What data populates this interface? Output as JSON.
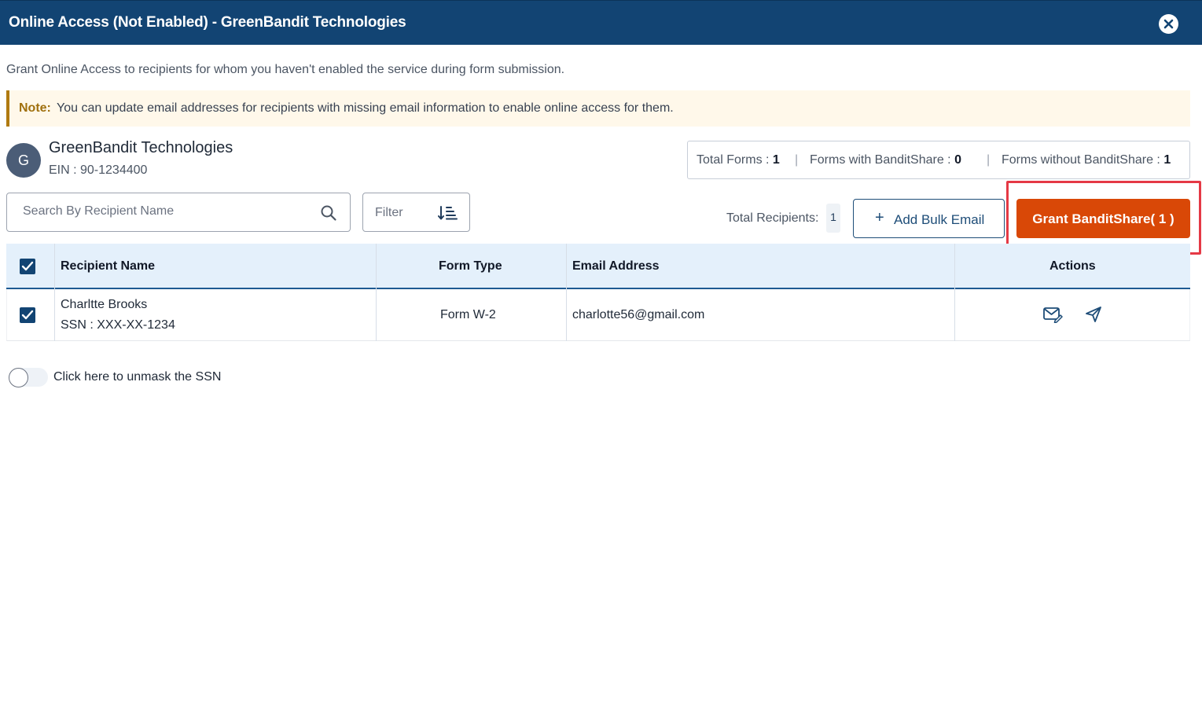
{
  "dialog": {
    "title": "Online Access (Not Enabled) - GreenBandit Technologies",
    "intro": "Grant Online Access to recipients for whom you haven't enabled the service during form submission.",
    "note_label": "Note:",
    "note_text": "You can update email addresses for recipients with missing email information to enable online access for them."
  },
  "company": {
    "avatar_letter": "G",
    "name": "GreenBandit Technologies",
    "ein": "EIN : 90-1234400"
  },
  "stats": {
    "total_forms_label": "Total Forms :",
    "total_forms_value": "1",
    "with_label": "Forms with BanditShare :",
    "with_value": "0",
    "without_label": "Forms without BanditShare :",
    "without_value": "1",
    "separator": "|"
  },
  "toolbar": {
    "search_placeholder": "Search By Recipient Name",
    "filter_label": "Filter",
    "total_recipients_label": "Total Recipients:",
    "total_recipients_value": "1",
    "add_bulk_email_label": "Add Bulk Email",
    "grant_label": "Grant BanditShare( 1 )"
  },
  "table": {
    "headers": {
      "recipient": "Recipient Name",
      "form_type": "Form Type",
      "email": "Email Address",
      "actions": "Actions"
    },
    "rows": [
      {
        "checked": true,
        "name": "Charltte Brooks",
        "ssn": "SSN : XXX-XX-1234",
        "form_type": "Form W-2",
        "email": "charlotte56@gmail.com"
      }
    ]
  },
  "unmask": {
    "label": "Click here to unmask the SSN",
    "enabled": false
  },
  "colors": {
    "header_bg": "#124473",
    "grant_button": "#d94807",
    "highlight_border": "#e53945",
    "note_bg": "#fff8ea"
  },
  "icons": {
    "close": "close-icon",
    "search": "search-icon",
    "filter": "sort-icon",
    "edit_email": "edit-email-icon",
    "send": "send-icon"
  }
}
